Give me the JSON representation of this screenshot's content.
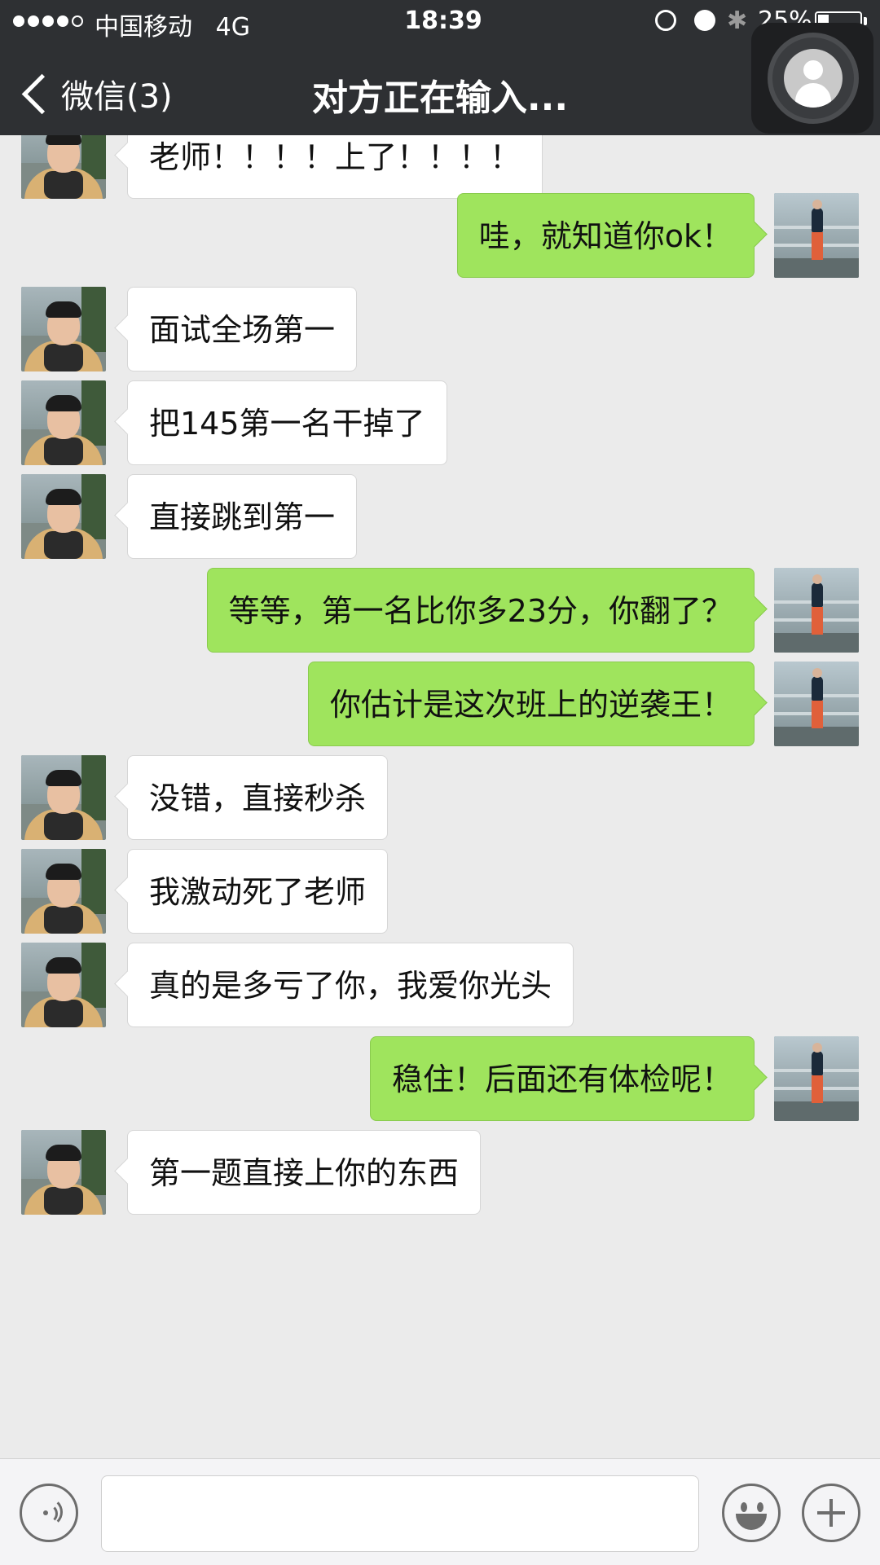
{
  "status_bar": {
    "carrier": "中国移动",
    "network": "4G",
    "time": "18:39",
    "battery": "25%",
    "battery_level": 0.25,
    "signal_bars_filled": 4,
    "signal_bars_total": 5
  },
  "nav": {
    "back_label": "微信(3)",
    "title": "对方正在输入..."
  },
  "messages": [
    {
      "side": "left",
      "text": "老师！！！！上了！！！！"
    },
    {
      "side": "right",
      "text": "哇，就知道你ok！"
    },
    {
      "side": "left",
      "text": "面试全场第一"
    },
    {
      "side": "left",
      "text": "把145第一名干掉了"
    },
    {
      "side": "left",
      "text": "直接跳到第一"
    },
    {
      "side": "right",
      "text": "等等，第一名比你多23分，你翻了？"
    },
    {
      "side": "right",
      "text": "你估计是这次班上的逆袭王！"
    },
    {
      "side": "left",
      "text": "没错，直接秒杀"
    },
    {
      "side": "left",
      "text": "我激动死了老师"
    },
    {
      "side": "left",
      "text": "真的是多亏了你，我爱你光头"
    },
    {
      "side": "right",
      "text": "稳住！后面还有体检呢！"
    },
    {
      "side": "left",
      "text": "第一题直接上你的东西"
    }
  ],
  "input_bar": {
    "text_value": "",
    "icons": [
      "voice-icon",
      "emoji-icon",
      "plus-icon"
    ]
  },
  "colors": {
    "header_bg": "#2e3033",
    "chat_bg": "#ebebeb",
    "outgoing_bubble": "#9fe45d",
    "incoming_bubble": "#ffffff"
  }
}
